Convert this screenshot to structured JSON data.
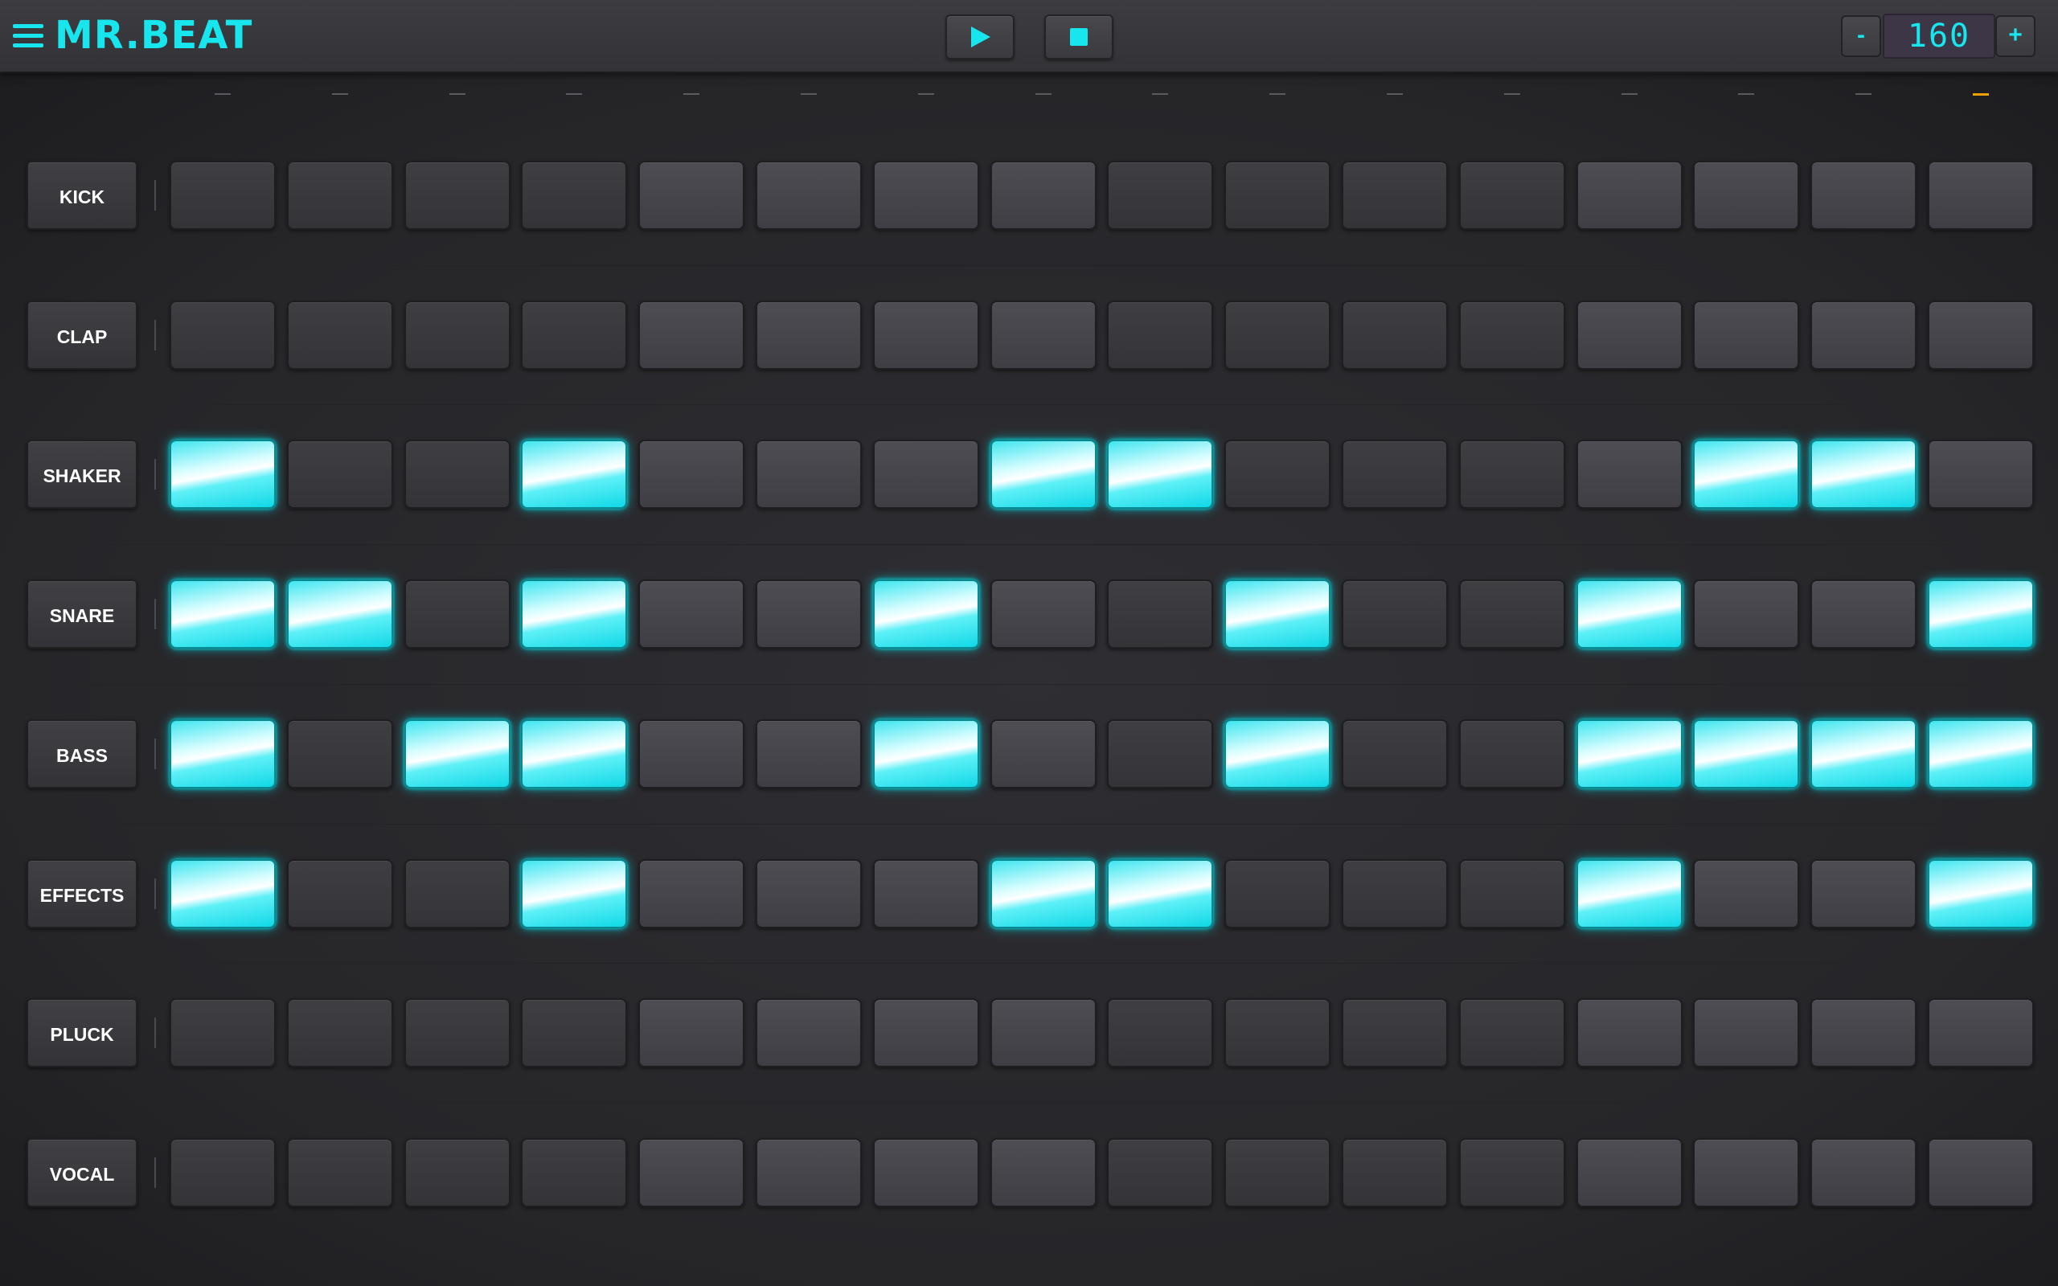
{
  "app": {
    "title": "MR.BEAT"
  },
  "transport": {
    "play": "play",
    "stop": "stop"
  },
  "tempo": {
    "minus": "-",
    "value": "160",
    "plus": "+"
  },
  "colors": {
    "accent": "#18e6ee",
    "playhead": "#f0a000",
    "background": "#2a2a2e"
  },
  "playhead_step": 16,
  "steps": 16,
  "tracks": [
    {
      "name": "KICK",
      "pattern": [
        0,
        0,
        0,
        0,
        0,
        0,
        0,
        0,
        0,
        0,
        0,
        0,
        0,
        0,
        0,
        0
      ]
    },
    {
      "name": "CLAP",
      "pattern": [
        0,
        0,
        0,
        0,
        0,
        0,
        0,
        0,
        0,
        0,
        0,
        0,
        0,
        0,
        0,
        0
      ]
    },
    {
      "name": "SHAKER",
      "pattern": [
        1,
        0,
        0,
        1,
        0,
        0,
        0,
        1,
        1,
        0,
        0,
        0,
        0,
        1,
        1,
        0
      ]
    },
    {
      "name": "SNARE",
      "pattern": [
        1,
        1,
        0,
        1,
        0,
        0,
        1,
        0,
        0,
        1,
        0,
        0,
        1,
        0,
        0,
        1
      ]
    },
    {
      "name": "BASS",
      "pattern": [
        1,
        0,
        1,
        1,
        0,
        0,
        1,
        0,
        0,
        1,
        0,
        0,
        1,
        1,
        1,
        1
      ]
    },
    {
      "name": "EFFECTS",
      "pattern": [
        1,
        0,
        0,
        1,
        0,
        0,
        0,
        1,
        1,
        0,
        0,
        0,
        1,
        0,
        0,
        1
      ]
    },
    {
      "name": "PLUCK",
      "pattern": [
        0,
        0,
        0,
        0,
        0,
        0,
        0,
        0,
        0,
        0,
        0,
        0,
        0,
        0,
        0,
        0
      ]
    },
    {
      "name": "VOCAL",
      "pattern": [
        0,
        0,
        0,
        0,
        0,
        0,
        0,
        0,
        0,
        0,
        0,
        0,
        0,
        0,
        0,
        0
      ]
    }
  ]
}
